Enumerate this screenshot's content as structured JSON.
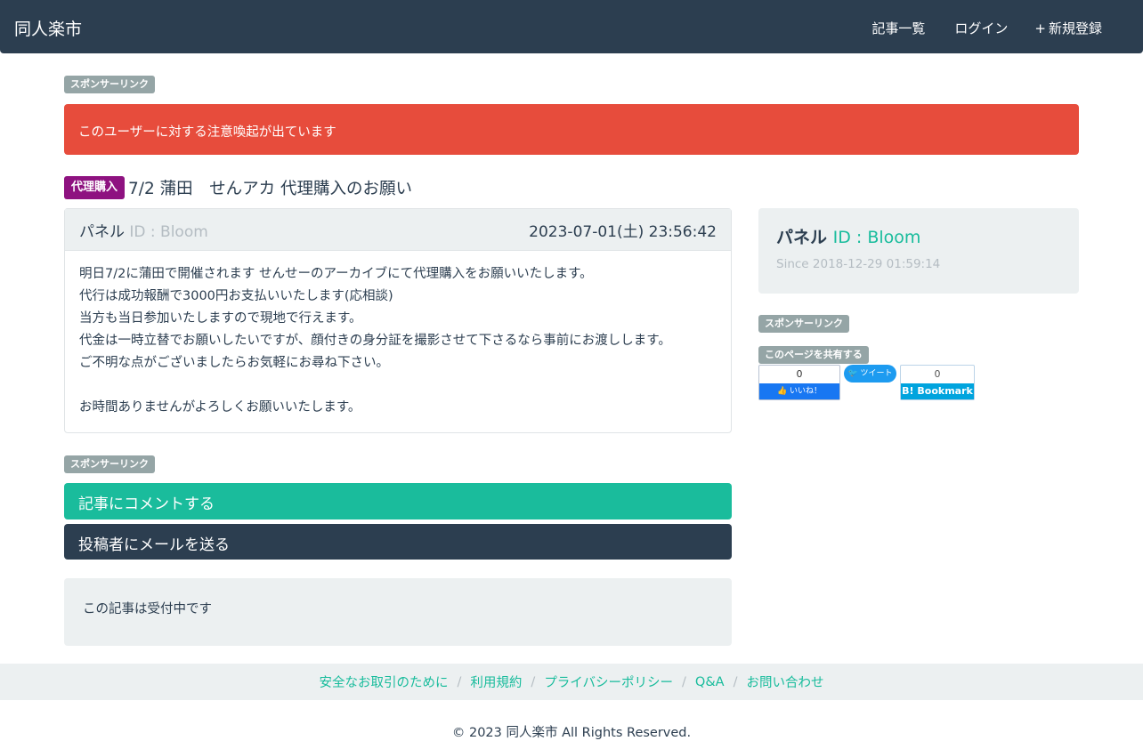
{
  "navbar": {
    "brand": "同人楽市",
    "links": [
      {
        "icon": "list-icon",
        "glyph": "",
        "label": "記事一覧"
      },
      {
        "icon": "login-icon",
        "glyph": "",
        "label": "ログイン"
      },
      {
        "icon": "plus-icon",
        "glyph": "+",
        "label": "新規登録"
      }
    ]
  },
  "sponsor_label": "スポンサーリンク",
  "alert": {
    "text": "このユーザーに対する注意喚起が出ています",
    "color": "#e74c3c"
  },
  "article": {
    "category": "代理購入",
    "title": "7/2 蒲田　せんアカ 代理購入のお願い",
    "author_icon": "user-icon",
    "author_glyph": "",
    "author": "パネル",
    "author_id": "ID : Bloom",
    "date_icon": "clock-icon",
    "date_glyph": "",
    "date": "2023-07-01(土) 23:56:42",
    "body_lines": [
      "明日7/2に蒲田で開催されます せんせーのアーカイブにて代理購入をお願いいたします。",
      "代行は成功報酬で3000円お支払いいたします(応相談)",
      "当方も当日参加いたしますので現地で行えます。",
      "代金は一時立替でお願いしたいですが、顔付きの身分証を撮影させて下さるなら事前にお渡しします。",
      "ご不明な点がございましたらお気軽にお尋ね下さい。",
      "",
      "お時間ありませんがよろしくお願いいたします。"
    ]
  },
  "buttons": {
    "comment": "記事にコメントする",
    "mail": "投稿者にメールを送る"
  },
  "status_text": "この記事は受付中です",
  "profile": {
    "icon_glyph": "",
    "name": "パネル",
    "id": "ID : Bloom",
    "since_glyph": "",
    "since": "Since 2018-12-29 01:59:14"
  },
  "share": {
    "label": "このページを共有する",
    "facebook": {
      "count": "0",
      "label": "いいね！"
    },
    "twitter": {
      "label": "ツイート"
    },
    "hatena": {
      "count": "0",
      "label": "B! Bookmark"
    }
  },
  "footer": {
    "links": [
      "安全なお取引のために",
      "利用規約",
      "プライバシーポリシー",
      "Q&A",
      "お問い合わせ"
    ],
    "separator": "/",
    "copyright": "© 2023 同人楽市 All Rights Reserved."
  }
}
